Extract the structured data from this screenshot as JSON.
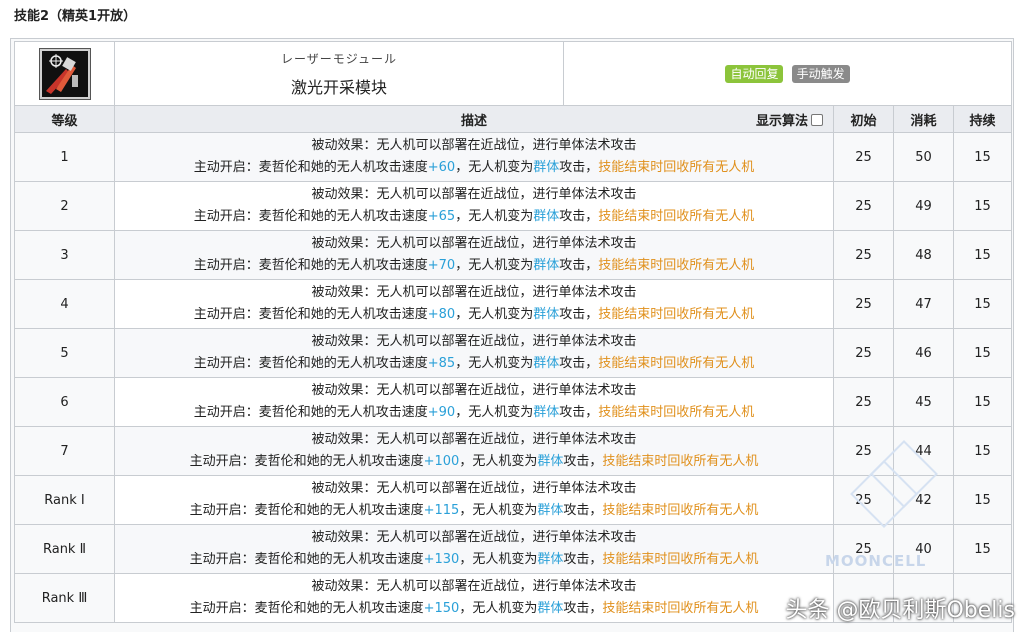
{
  "section_title": "技能2（精英1开放）",
  "skill": {
    "name_jp": "レーザーモジュール",
    "name_cn": "激光开采模块",
    "tags": [
      "自动回复",
      "手动触发"
    ],
    "colors": {
      "tag_auto": "#8cc43b",
      "tag_manual": "#8a8a8a",
      "value_blue": "#2aa0d8",
      "value_orange": "#e0901c"
    }
  },
  "columns": {
    "level": "等级",
    "description": "描述",
    "show_algorithm": "显示算法",
    "initial": "初始",
    "cost": "消耗",
    "duration": "持续"
  },
  "desc_text": {
    "passive": "被动效果：无人机可以部署在近战位，进行单体法术攻击",
    "active_prefix": "主动开启：麦哲伦和她的无人机攻击速度",
    "active_mid": "，无人机变为",
    "group": "群体",
    "attack": "攻击，",
    "recall": "技能结束时回收所有无人机"
  },
  "rows": [
    {
      "level": "1",
      "speed": "+60",
      "initial": "25",
      "cost": "50",
      "duration": "15"
    },
    {
      "level": "2",
      "speed": "+65",
      "initial": "25",
      "cost": "49",
      "duration": "15"
    },
    {
      "level": "3",
      "speed": "+70",
      "initial": "25",
      "cost": "48",
      "duration": "15"
    },
    {
      "level": "4",
      "speed": "+80",
      "initial": "25",
      "cost": "47",
      "duration": "15"
    },
    {
      "level": "5",
      "speed": "+85",
      "initial": "25",
      "cost": "46",
      "duration": "15"
    },
    {
      "level": "6",
      "speed": "+90",
      "initial": "25",
      "cost": "45",
      "duration": "15"
    },
    {
      "level": "7",
      "speed": "+100",
      "initial": "25",
      "cost": "44",
      "duration": "15"
    },
    {
      "level": "Rank Ⅰ",
      "speed": "+115",
      "initial": "25",
      "cost": "42",
      "duration": "15"
    },
    {
      "level": "Rank Ⅱ",
      "speed": "+130",
      "initial": "25",
      "cost": "40",
      "duration": "15"
    },
    {
      "level": "Rank Ⅲ",
      "speed": "+150",
      "initial": "",
      "cost": "",
      "duration": ""
    }
  ],
  "watermark": "头条 @欧贝利斯Obelis",
  "background_mark": "MOONCELL",
  "icons": {
    "skill": "laser-drone-icon",
    "checkbox": "checkbox-icon"
  }
}
